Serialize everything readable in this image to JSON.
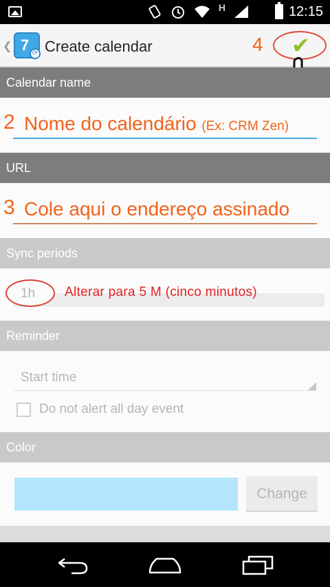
{
  "status_bar": {
    "time": "12:15",
    "network_label": "H",
    "icons": [
      "image-icon",
      "vibrate-icon",
      "alarm-icon",
      "wifi-icon",
      "signal-icon",
      "battery-icon"
    ]
  },
  "action_bar": {
    "title": "Create calendar",
    "app_icon_text": "7",
    "step_label": "4",
    "confirm_icon": "check-icon"
  },
  "sections": {
    "calendar_name": {
      "header": "Calendar name",
      "step": "2",
      "hint": "Nome do calendário",
      "hint_small": "(Ex: CRM Zen)"
    },
    "url": {
      "header": "URL",
      "step": "3",
      "hint": "Cole aqui o endereço assinado"
    },
    "sync_periods": {
      "header": "Sync periods",
      "value": "1h",
      "note": "Alterar para 5 M (cinco minutos)"
    },
    "reminder": {
      "header": "Reminder",
      "start_time_placeholder": "Start time",
      "checkbox_label": "Do not alert all day event",
      "checkbox_checked": false
    },
    "color": {
      "header": "Color",
      "swatch_color": "#b3e5fc",
      "change_button": "Change"
    }
  },
  "colors": {
    "annotation_orange": "#f2621a",
    "annotation_red": "#e52020",
    "accent_blue": "#4aa9e0",
    "check_green": "#8cbe2b"
  }
}
